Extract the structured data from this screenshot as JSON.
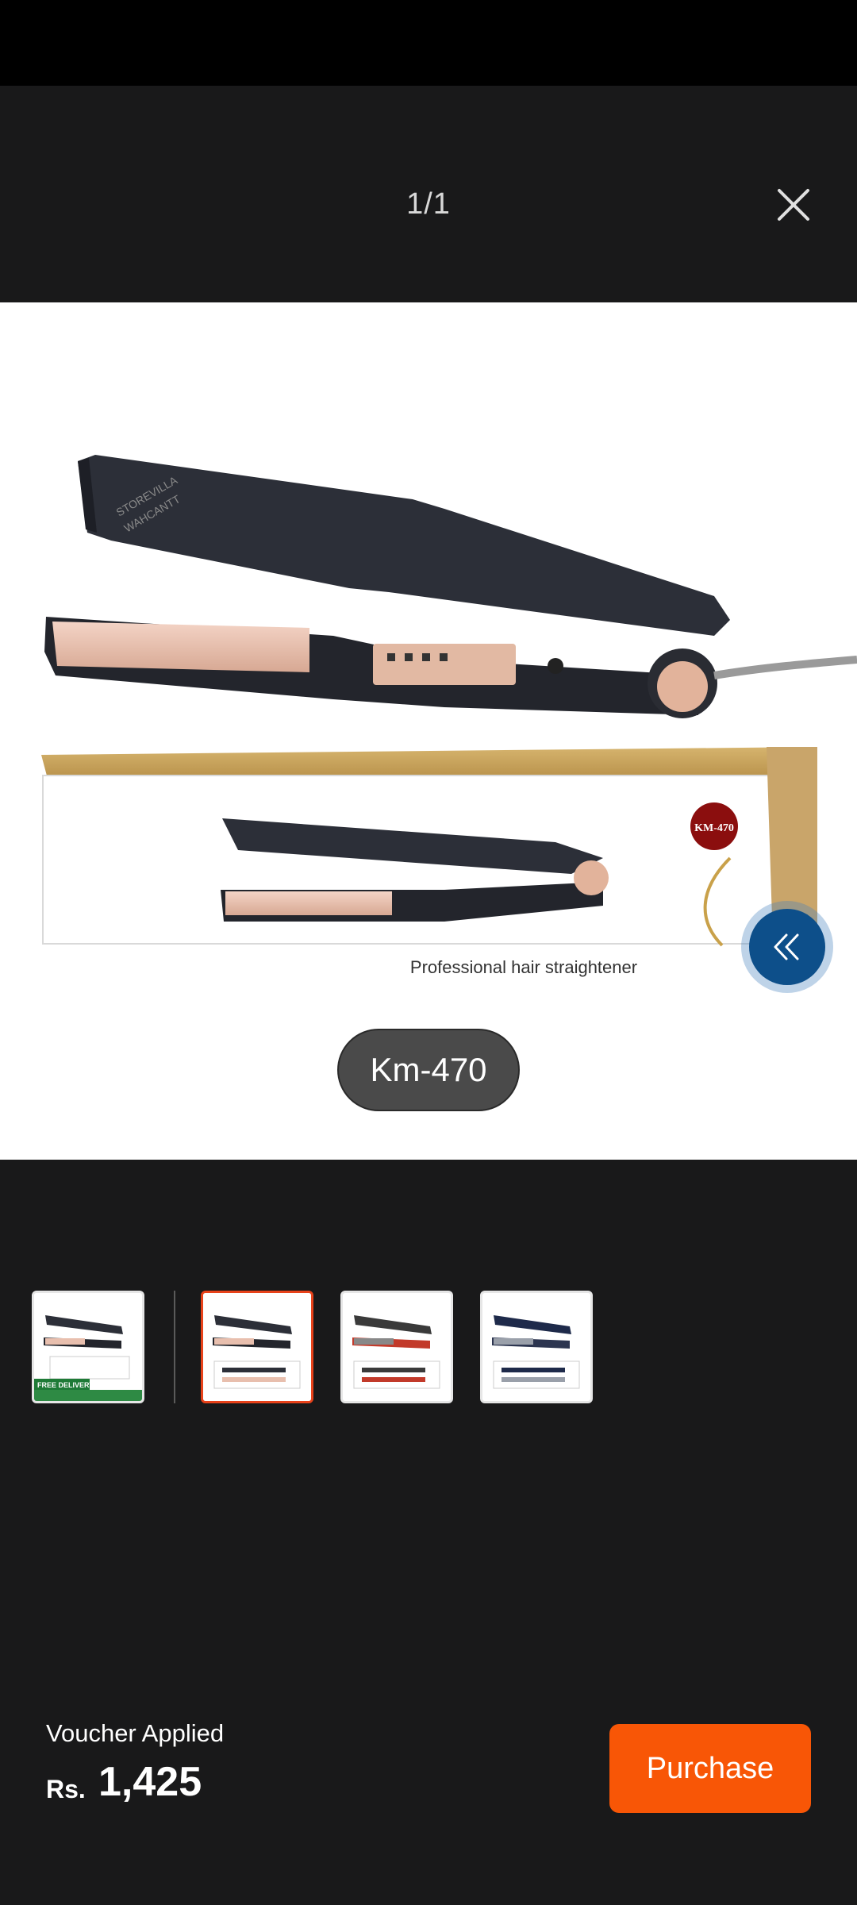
{
  "viewer": {
    "page_counter": "1/1",
    "close_icon": "close-icon"
  },
  "image": {
    "box_caption": "Professional  hair straightener",
    "box_badge": "KM-470",
    "watermark_line1": "STOREVILLA",
    "watermark_line2": "WAHCANTT"
  },
  "variant": {
    "label": "Km-470"
  },
  "collapse_button": {
    "icon": "double-chevron-left-icon"
  },
  "thumbnails": [
    {
      "name": "thumb-1",
      "selected": false,
      "banner": "FREE DELIVERY"
    },
    {
      "name": "thumb-2",
      "selected": true
    },
    {
      "name": "thumb-3",
      "selected": false
    },
    {
      "name": "thumb-4",
      "selected": false
    }
  ],
  "footer": {
    "voucher_label": "Voucher Applied",
    "currency": "Rs.",
    "price": "1,425",
    "purchase_label": "Purchase"
  },
  "colors": {
    "accent": "#f85606",
    "selected_border": "#e8421a",
    "background": "#19191a"
  }
}
